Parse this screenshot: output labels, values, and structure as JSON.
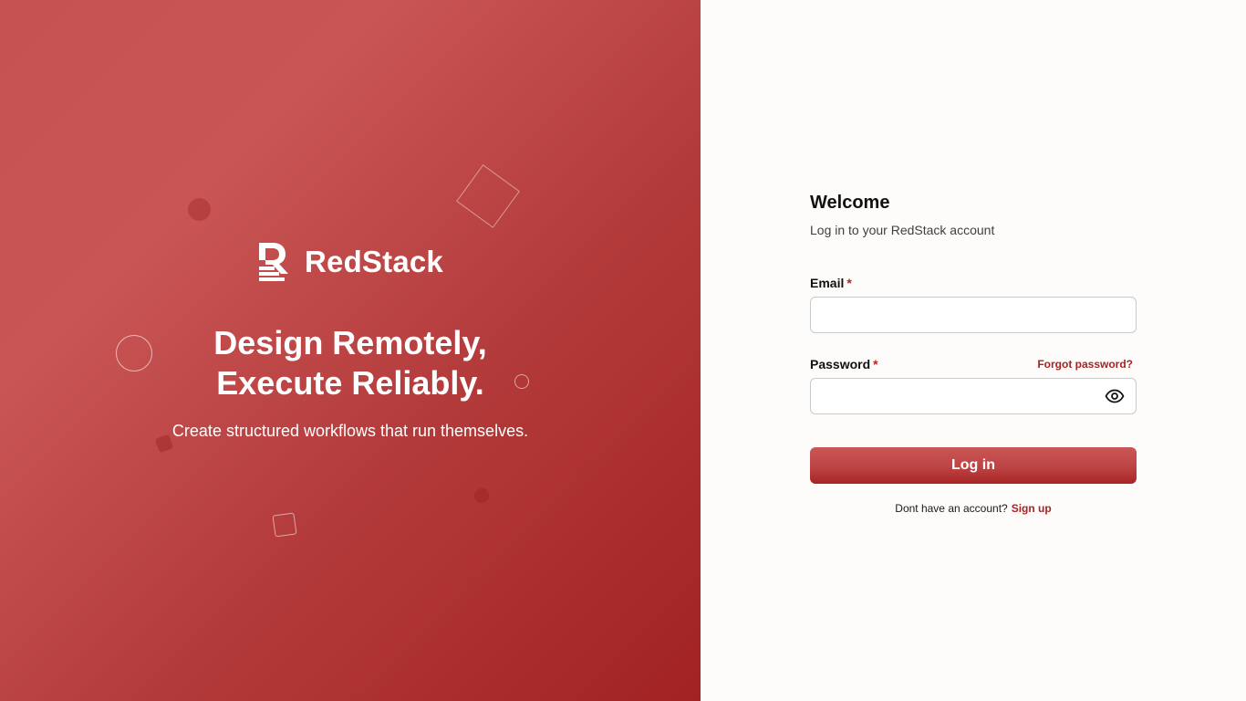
{
  "hero": {
    "brand_name": "RedStack",
    "headline_line1": "Design Remotely,",
    "headline_line2": "Execute Reliably.",
    "tagline": "Create structured workflows that run themselves."
  },
  "login": {
    "title": "Welcome",
    "subtitle": "Log in to your RedStack account",
    "email_label": "Email",
    "email_value": "",
    "password_label": "Password",
    "password_value": "",
    "required_marker": "*",
    "forgot_password": "Forgot password?",
    "submit_label": "Log in",
    "no_account_text": "Dont have an account?",
    "signup_link": "Sign up"
  },
  "icons": {
    "password_toggle": "eye-icon",
    "brand_logo": "redstack-logo"
  },
  "colors": {
    "brand_red": "#c65252",
    "brand_dark_red": "#a22222",
    "link_red": "#a82323",
    "panel_background": "#fdfcfb"
  }
}
